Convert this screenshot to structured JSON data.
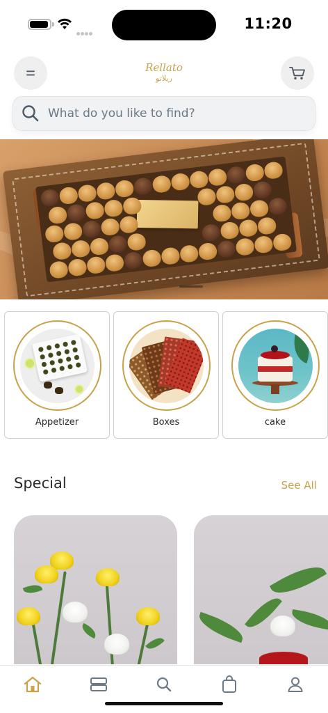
{
  "status_bar": {
    "time": "11:20"
  },
  "header": {
    "logo_latin": "Rellato",
    "logo_arabic": "ريلاتو",
    "menu_icon": "menu-icon",
    "cart_icon": "cart-icon"
  },
  "search": {
    "placeholder": "What do you like to find?",
    "icon": "search-icon"
  },
  "banner": {
    "slide_indicator": "slide-indicator"
  },
  "categories": [
    {
      "label": "Appetizer"
    },
    {
      "label": "Boxes"
    },
    {
      "label": "cake"
    }
  ],
  "special": {
    "title": "Special",
    "see_all": "See All"
  },
  "tabbar": {
    "items": [
      {
        "icon": "home-icon",
        "active": true
      },
      {
        "icon": "categories-icon",
        "active": false
      },
      {
        "icon": "search-icon",
        "active": false
      },
      {
        "icon": "bag-icon",
        "active": false
      },
      {
        "icon": "profile-icon",
        "active": false
      }
    ]
  },
  "colors": {
    "accent_gold": "#c9a24a",
    "tab_icon": "#6b7885",
    "search_bg": "#f1f2f3"
  }
}
